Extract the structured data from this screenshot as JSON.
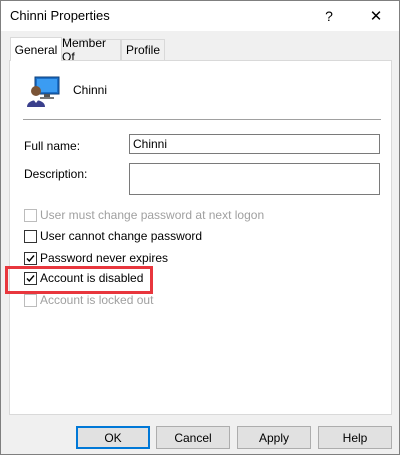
{
  "window": {
    "title": "Chinni Properties",
    "help_glyph": "?",
    "close_glyph": "✕"
  },
  "tabs": [
    {
      "label": "General",
      "active": true
    },
    {
      "label": "Member Of",
      "active": false
    },
    {
      "label": "Profile",
      "active": false
    }
  ],
  "general": {
    "user_display_name": "Chinni",
    "full_name_label": "Full name:",
    "full_name_value": "Chinni",
    "description_label": "Description:",
    "description_value": ""
  },
  "options": [
    {
      "label": "User must change password at next logon",
      "checked": false,
      "enabled": false
    },
    {
      "label": "User cannot change password",
      "checked": false,
      "enabled": true
    },
    {
      "label": "Password never expires",
      "checked": true,
      "enabled": true
    },
    {
      "label": "Account is disabled",
      "checked": true,
      "enabled": true
    },
    {
      "label": "Account is locked out",
      "checked": false,
      "enabled": false
    }
  ],
  "buttons": {
    "ok": "OK",
    "cancel": "Cancel",
    "apply": "Apply",
    "help": "Help"
  },
  "colors": {
    "highlight": "#e8363d",
    "default_button_border": "#0078d7"
  }
}
